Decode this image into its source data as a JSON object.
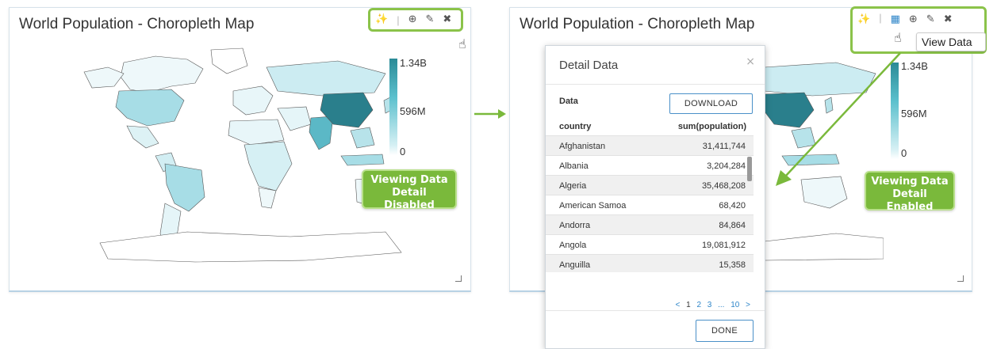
{
  "left_panel": {
    "title": "World Population - Choropleth Map",
    "legend": {
      "max": "1.34B",
      "mid": "596M",
      "min": "0"
    },
    "callout": {
      "line1": "Viewing Data",
      "line2": "Detail Disabled"
    },
    "toolbar": {
      "icons": [
        "magic-wand-icon",
        "download-icon",
        "pencil-icon",
        "close-icon"
      ]
    }
  },
  "right_panel": {
    "title": "World Population - Choropleth Map",
    "legend": {
      "max": "1.34B",
      "mid": "596M",
      "min": "0"
    },
    "callout": {
      "line1": "Viewing Data",
      "line2": "Detail Enabled"
    },
    "tooltip": "View Data",
    "toolbar": {
      "icons": [
        "magic-wand-icon",
        "table-icon",
        "download-icon",
        "pencil-icon",
        "close-icon"
      ]
    }
  },
  "modal": {
    "title": "Detail Data",
    "close_glyph": "×",
    "section_label": "Data",
    "download_label": "DOWNLOAD",
    "done_label": "DONE",
    "columns": [
      "country",
      "sum(population)"
    ],
    "rows": [
      {
        "country": "Afghanistan",
        "population": "31,411,744"
      },
      {
        "country": "Albania",
        "population": "3,204,284"
      },
      {
        "country": "Algeria",
        "population": "35,468,208"
      },
      {
        "country": "American Samoa",
        "population": "68,420"
      },
      {
        "country": "Andorra",
        "population": "84,864"
      },
      {
        "country": "Angola",
        "population": "19,081,912"
      },
      {
        "country": "Anguilla",
        "population": "15,358"
      }
    ],
    "pagination": {
      "prev": "<",
      "current": "1",
      "pages": [
        "2",
        "3",
        "...",
        "10"
      ],
      "next": ">"
    }
  },
  "colors": {
    "accent_green": "#7ab93b",
    "highlight_border": "#8bc34a",
    "map_dark": "#2a8a96",
    "map_light": "#d6f0f4",
    "link_blue": "#2f86c9"
  }
}
